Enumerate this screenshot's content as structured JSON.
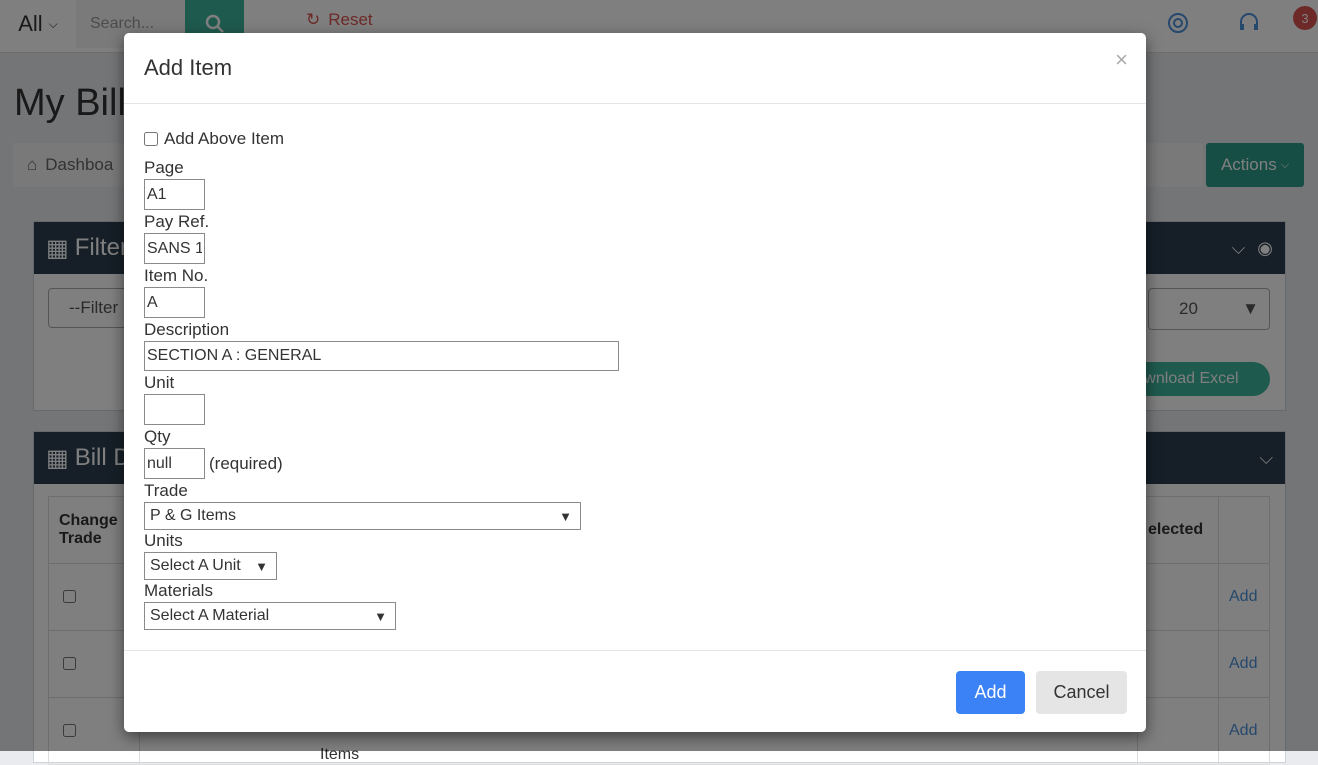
{
  "topbar": {
    "scope": "All",
    "search_placeholder": "Search...",
    "reset_label": "Reset",
    "notification_count": "3"
  },
  "page": {
    "title": "My Bill",
    "breadcrumb": "Dashboa",
    "actions_label": "Actions"
  },
  "filters_panel": {
    "title": "Filters",
    "filter_select": "--Filter",
    "per_page": "20",
    "excel_label": "ownload Excel"
  },
  "bill_panel": {
    "title": "Bill D",
    "headers": [
      "Change Trade",
      "elected"
    ],
    "rows": [
      {
        "action": "Add"
      },
      {
        "action": "Add"
      },
      {
        "action": "Add",
        "note": "Items"
      }
    ]
  },
  "modal": {
    "title": "Add Item",
    "close_glyph": "×",
    "add_above_label": "Add Above Item",
    "fields": {
      "page_label": "Page",
      "page_value": "A1",
      "payref_label": "Pay Ref.",
      "payref_value": "SANS 1",
      "itemno_label": "Item No.",
      "itemno_value": "A",
      "desc_label": "Description",
      "desc_value": "SECTION A : GENERAL",
      "unit_label": "Unit",
      "unit_value": "",
      "qty_label": "Qty",
      "qty_value": "null",
      "qty_hint": "(required)",
      "trade_label": "Trade",
      "trade_value": "P & G Items",
      "units_label": "Units",
      "units_value": "Select A Unit",
      "materials_label": "Materials",
      "materials_value": "Select A Material"
    },
    "add_button": "Add",
    "cancel_button": "Cancel"
  },
  "colors": {
    "primary": "#3b82f6",
    "teal": "#3fb59d",
    "panel_head": "#2c3e50",
    "danger": "#d9534f"
  }
}
